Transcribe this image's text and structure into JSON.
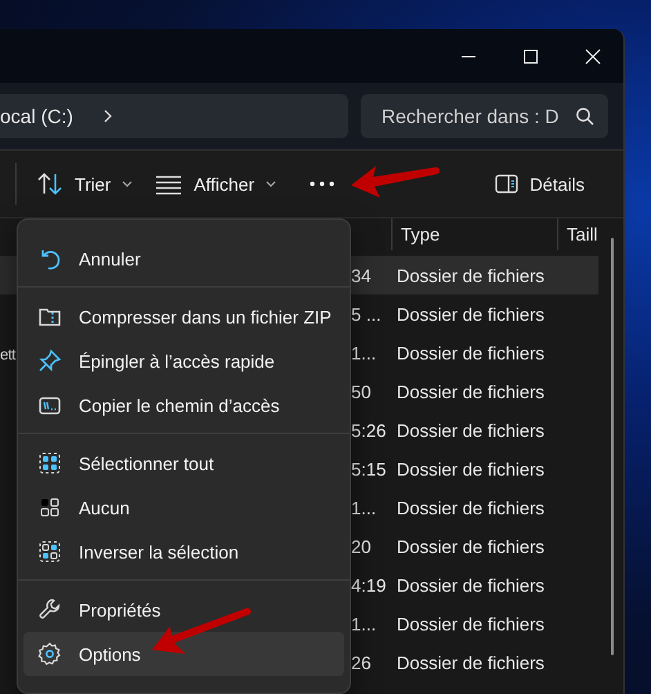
{
  "address_bar": {
    "path": "ocal (C:)"
  },
  "search": {
    "placeholder": "Rechercher dans : D"
  },
  "toolbar": {
    "items": [
      {
        "kind": "sort",
        "label": "Trier"
      },
      {
        "kind": "view",
        "label": "Afficher"
      },
      {
        "kind": "more"
      }
    ],
    "details": {
      "label": "Détails"
    }
  },
  "columns": [
    {
      "label": "Type"
    },
    {
      "label": "Taill"
    }
  ],
  "rows": [
    {
      "column_2": "34",
      "type": "Dossier de fichiers",
      "selected": true
    },
    {
      "column_2": "5 ...",
      "type": "Dossier de fichiers",
      "selected": false
    },
    {
      "column_1": "ett",
      "column_2": "1...",
      "type": "Dossier de fichiers",
      "selected": false
    },
    {
      "column_2": "50",
      "type": "Dossier de fichiers",
      "selected": false
    },
    {
      "column_2": "5:26",
      "type": "Dossier de fichiers",
      "selected": false
    },
    {
      "column_2": "5:15",
      "type": "Dossier de fichiers",
      "selected": false
    },
    {
      "column_2": "1...",
      "type": "Dossier de fichiers",
      "selected": false
    },
    {
      "column_2": "20",
      "type": "Dossier de fichiers",
      "selected": false
    },
    {
      "column_2": "4:19",
      "type": "Dossier de fichiers",
      "selected": false
    },
    {
      "column_2": "1...",
      "type": "Dossier de fichiers",
      "selected": false
    },
    {
      "column_2": "26",
      "type": "Dossier de fichiers",
      "selected": false
    }
  ],
  "menu": {
    "groups": [
      [
        {
          "kind": "undo",
          "label": "Annuler",
          "selected": false
        }
      ],
      [
        {
          "kind": "zip",
          "label": "Compresser dans un fichier ZIP",
          "selected": false
        },
        {
          "kind": "pin",
          "label": "Épingler à l’accès rapide",
          "selected": false
        },
        {
          "kind": "copy_path",
          "label": "Copier le chemin d’accès",
          "selected": false
        }
      ],
      [
        {
          "kind": "select_all",
          "label": "Sélectionner tout",
          "selected": false
        },
        {
          "kind": "select_none",
          "label": "Aucun",
          "selected": false
        },
        {
          "kind": "invert",
          "label": "Inverser la sélection",
          "selected": false
        }
      ],
      [
        {
          "kind": "properties",
          "label": "Propriétés",
          "selected": false
        },
        {
          "kind": "options",
          "label": "Options",
          "selected": true
        }
      ]
    ]
  }
}
